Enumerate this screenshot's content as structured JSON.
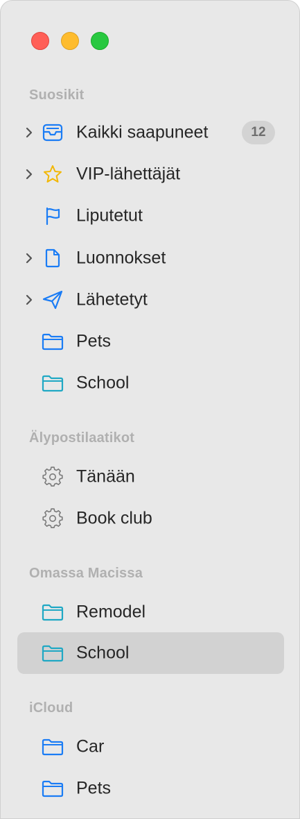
{
  "window": {
    "traffic_lights": [
      "close",
      "minimize",
      "zoom"
    ]
  },
  "sections": {
    "favorites": {
      "header": "Suosikit",
      "items": [
        {
          "label": "Kaikki saapuneet",
          "icon": "inbox-icon",
          "badge": "12",
          "expandable": true
        },
        {
          "label": "VIP-lähettäjät",
          "icon": "star-icon",
          "expandable": true
        },
        {
          "label": "Liputetut",
          "icon": "flag-icon",
          "expandable": false
        },
        {
          "label": "Luonnokset",
          "icon": "document-icon",
          "expandable": true
        },
        {
          "label": "Lähetetyt",
          "icon": "paperplane-icon",
          "expandable": true
        },
        {
          "label": "Pets",
          "icon": "folder-icon",
          "expandable": false
        },
        {
          "label": "School",
          "icon": "folder-icon",
          "expandable": false
        }
      ]
    },
    "smart": {
      "header": "Älypostilaatikot",
      "items": [
        {
          "label": "Tänään",
          "icon": "gear-icon"
        },
        {
          "label": "Book club",
          "icon": "gear-icon"
        }
      ]
    },
    "on_my_mac": {
      "header": "Omassa Macissa",
      "items": [
        {
          "label": "Remodel",
          "icon": "folder-icon"
        },
        {
          "label": "School",
          "icon": "folder-icon",
          "selected": true
        }
      ]
    },
    "icloud": {
      "header": "iCloud",
      "items": [
        {
          "label": "Car",
          "icon": "folder-icon"
        },
        {
          "label": "Pets",
          "icon": "folder-icon"
        }
      ]
    }
  },
  "colors": {
    "accent_blue": "#1a7cf5",
    "teal": "#1fa8c4",
    "star_yellow": "#f2b705",
    "gear_gray": "#7a7a7a",
    "sidebar_bg": "#e8e8e8",
    "selection_bg": "#d2d2d2"
  }
}
